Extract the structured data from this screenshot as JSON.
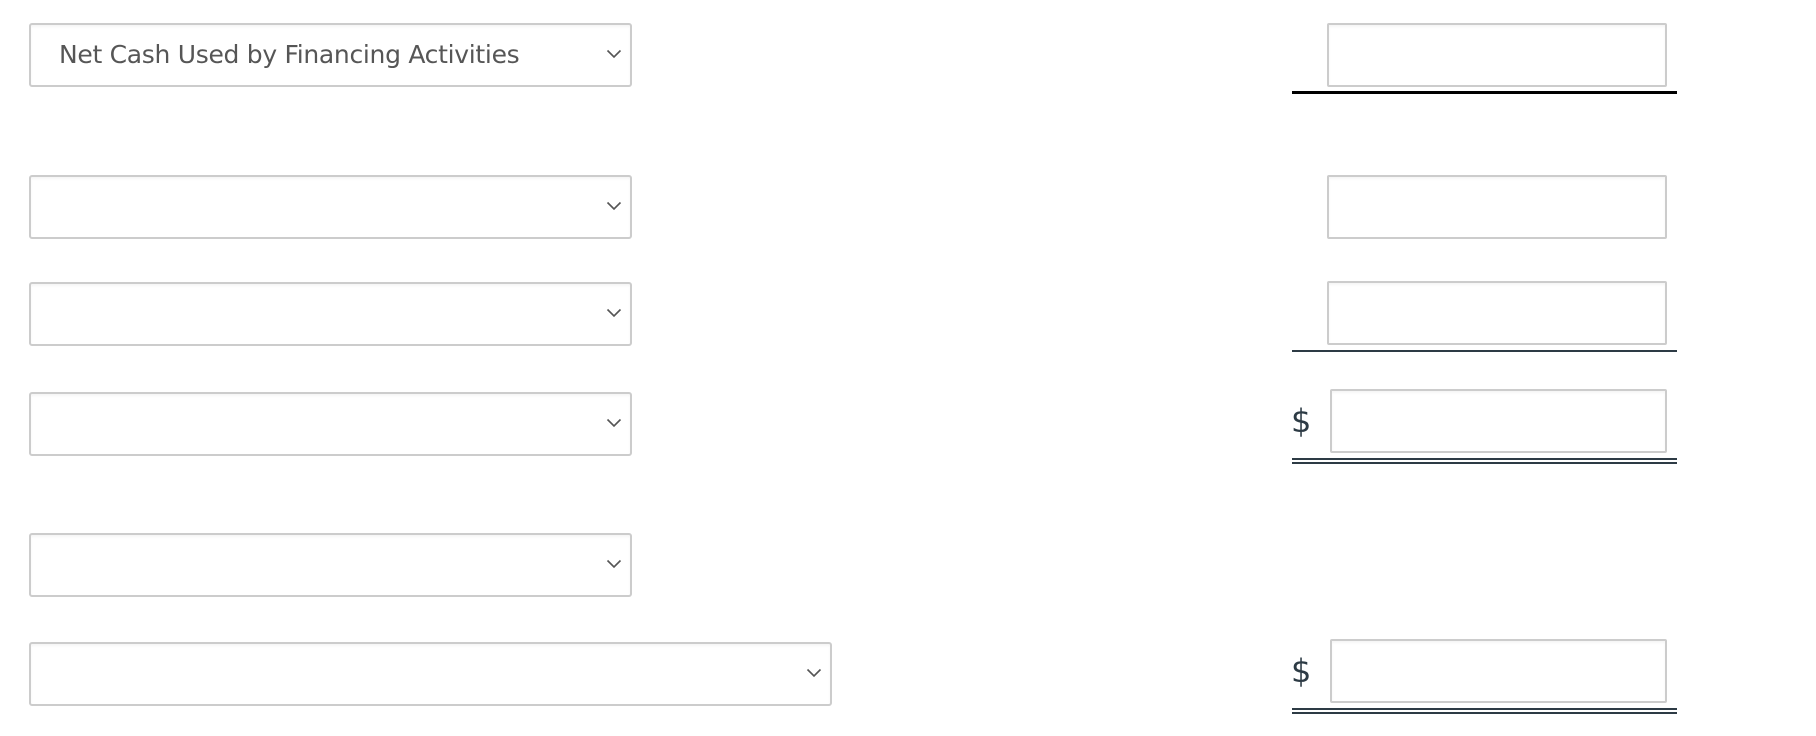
{
  "rows": [
    {
      "select": {
        "value": "Net Cash Used by Financing Activities",
        "selected": true
      },
      "amount": {
        "value": "",
        "placeholder": ""
      },
      "currency_symbol": "",
      "underline": "single"
    },
    {
      "select": {
        "value": "",
        "selected": false
      },
      "amount": {
        "value": "",
        "placeholder": ""
      },
      "currency_symbol": "",
      "underline": "none"
    },
    {
      "select": {
        "value": "",
        "selected": false
      },
      "amount": {
        "value": "",
        "placeholder": ""
      },
      "currency_symbol": "",
      "underline": "single"
    },
    {
      "select": {
        "value": "",
        "selected": false
      },
      "amount": {
        "value": "",
        "placeholder": ""
      },
      "currency_symbol": "$",
      "underline": "double"
    },
    {
      "select": {
        "value": "",
        "selected": false
      },
      "currency_symbol": "",
      "underline": "none"
    },
    {
      "select": {
        "value": "",
        "selected": false
      },
      "amount": {
        "value": "",
        "placeholder": ""
      },
      "currency_symbol": "$",
      "underline": "double"
    }
  ],
  "icons": {
    "dropdown": "chevron-down-icon"
  },
  "colors": {
    "border": "#cccccc",
    "select_text": "#565656",
    "rule_total": "#2d3b45",
    "rule_subtotal": "#000000"
  }
}
